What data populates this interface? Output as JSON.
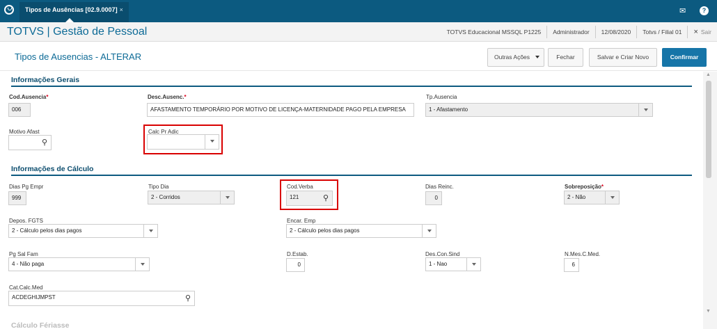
{
  "topbar": {
    "tab_label": "Tipos de Ausências [02.9.0007]",
    "tab_close": "×"
  },
  "titlebar": {
    "app_title": "TOTVS | Gestão de Pessoal",
    "company": "TOTVS Educacional MSSQL P1225",
    "user": "Administrador",
    "date": "12/08/2020",
    "branch": "Totvs / Filial 01",
    "exit_icon": "×",
    "exit_label": "Sair"
  },
  "header": {
    "page_title": "Tipos de Ausencias - ALTERAR",
    "buttons": {
      "other_actions": "Outras Ações",
      "close": "Fechar",
      "save_new": "Salvar e Criar Novo",
      "confirm": "Confirmar"
    }
  },
  "sections": {
    "general": "Informações Gerais",
    "calc": "Informações de Cálculo",
    "next": "Cálculo Fériasse"
  },
  "fields": {
    "cod_ausencia": {
      "label": "Cod.Ausencia",
      "req": "*",
      "value": "006"
    },
    "desc_ausenc": {
      "label": "Desc.Ausenc.",
      "req": "*",
      "value": "AFASTAMENTO TEMPORÁRIO POR MOTIVO DE LICENÇA-MATERNIDADE PAGO PELA EMPRESA"
    },
    "tp_ausencia": {
      "label": "Tp.Ausencia",
      "value": "1 - Afastamento"
    },
    "motivo_afast": {
      "label": "Motivo Afast",
      "value": ""
    },
    "calc_pr_adic": {
      "label": "Calc Pr Adic",
      "value": ""
    },
    "dias_pg_empr": {
      "label": "Dias Pg Empr",
      "value": "999"
    },
    "tipo_dia": {
      "label": "Tipo Dia",
      "value": "2 - Corridos"
    },
    "cod_verba": {
      "label": "Cod.Verba",
      "value": "121"
    },
    "dias_reinc": {
      "label": "Dias Reinc.",
      "value": "0"
    },
    "sobreposicao": {
      "label": "Sobreposição",
      "req": "*",
      "value": "2 - Não"
    },
    "depos_fgts": {
      "label": "Depos. FGTS",
      "value": "2 - Cálculo pelos dias pagos"
    },
    "encar_emp": {
      "label": "Encar. Emp",
      "value": "2 - Cálculo pelos dias pagos"
    },
    "pg_sal_fam": {
      "label": "Pg Sal Fam",
      "value": "4 - Não paga"
    },
    "d_estab": {
      "label": "D.Estab.",
      "value": "0"
    },
    "des_con_sind": {
      "label": "Des.Con.Sind",
      "value": "1 - Nao"
    },
    "n_mes_c_med": {
      "label": "N.Mes.C.Med.",
      "value": "6"
    },
    "cat_calc_med": {
      "label": "Cat.Calc.Med",
      "value": "ACDEGHIJMPST"
    }
  },
  "colors": {
    "brand": "#0c5a80",
    "primary": "#1675a8",
    "highlight": "#d90000"
  }
}
